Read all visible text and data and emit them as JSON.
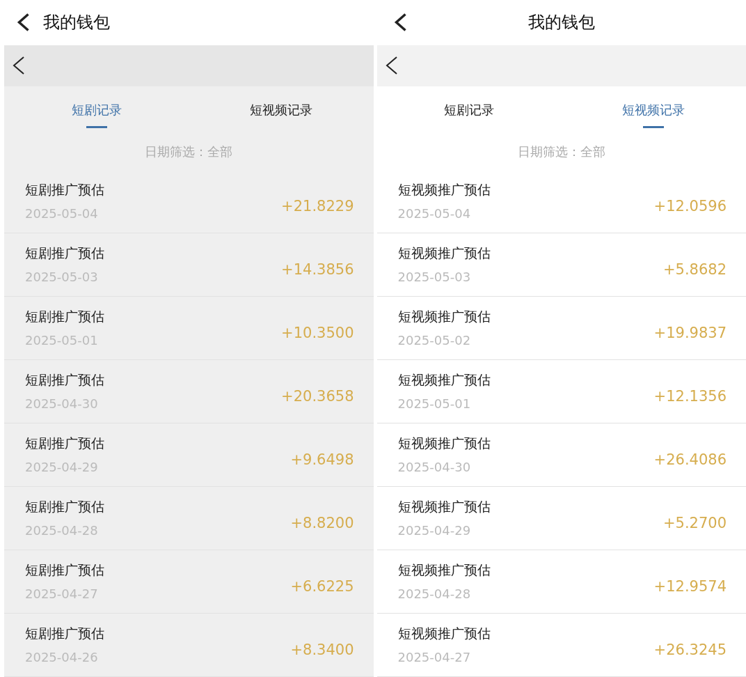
{
  "panels": [
    {
      "header": {
        "title": "我的钱包"
      },
      "tabs": [
        {
          "label": "短剧记录",
          "selected": true
        },
        {
          "label": "短视频记录",
          "selected": false
        }
      ],
      "filter": "日期筛选：全部",
      "records": [
        {
          "title": "短剧推广预估",
          "date": "2025-05-04",
          "amount": "+21.8229"
        },
        {
          "title": "短剧推广预估",
          "date": "2025-05-03",
          "amount": "+14.3856"
        },
        {
          "title": "短剧推广预估",
          "date": "2025-05-01",
          "amount": "+10.3500"
        },
        {
          "title": "短剧推广预估",
          "date": "2025-04-30",
          "amount": "+20.3658"
        },
        {
          "title": "短剧推广预估",
          "date": "2025-04-29",
          "amount": "+9.6498"
        },
        {
          "title": "短剧推广预估",
          "date": "2025-04-28",
          "amount": "+8.8200"
        },
        {
          "title": "短剧推广预估",
          "date": "2025-04-27",
          "amount": "+6.6225"
        },
        {
          "title": "短剧推广预估",
          "date": "2025-04-26",
          "amount": "+8.3400"
        }
      ]
    },
    {
      "header": {
        "title": "我的钱包"
      },
      "tabs": [
        {
          "label": "短剧记录",
          "selected": false
        },
        {
          "label": "短视频记录",
          "selected": true
        }
      ],
      "filter": "日期筛选：全部",
      "records": [
        {
          "title": "短视频推广预估",
          "date": "2025-05-04",
          "amount": "+12.0596"
        },
        {
          "title": "短视频推广预估",
          "date": "2025-05-03",
          "amount": "+5.8682"
        },
        {
          "title": "短视频推广预估",
          "date": "2025-05-02",
          "amount": "+19.9837"
        },
        {
          "title": "短视频推广预估",
          "date": "2025-05-01",
          "amount": "+12.1356"
        },
        {
          "title": "短视频推广预估",
          "date": "2025-04-30",
          "amount": "+26.4086"
        },
        {
          "title": "短视频推广预估",
          "date": "2025-04-29",
          "amount": "+5.2700"
        },
        {
          "title": "短视频推广预估",
          "date": "2025-04-28",
          "amount": "+12.9574"
        },
        {
          "title": "短视频推广预估",
          "date": "2025-04-27",
          "amount": "+26.3245"
        }
      ]
    }
  ]
}
